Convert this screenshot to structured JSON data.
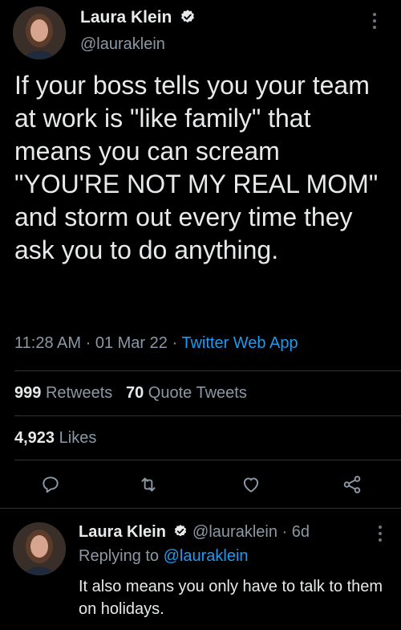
{
  "tweet": {
    "author_name": "Laura Klein",
    "author_handle": "@lauraklein",
    "text": "If your boss tells you your team at work is \"like family\" that means you can scream \"YOU'RE NOT MY REAL MOM\" and storm out every time they ask you to do anything.",
    "time": "11:28 AM",
    "date": "01 Mar 22",
    "separator": "·",
    "source_app": "Twitter Web App",
    "retweets_count": "999",
    "retweets_label": "Retweets",
    "quotes_count": "70",
    "quotes_label": "Quote Tweets",
    "likes_count": "4,923",
    "likes_label": "Likes"
  },
  "reply": {
    "author_name": "Laura Klein",
    "author_handle": "@lauraklein",
    "age": "6d",
    "replying_prefix": "Replying to",
    "replying_to": "@lauraklein",
    "text": "It also means you only have to talk to them on holidays."
  },
  "icons": {
    "verified": "verified-badge-icon",
    "more": "more-vertical-icon",
    "reply": "reply-icon",
    "retweet": "retweet-icon",
    "like": "heart-icon",
    "share": "share-icon"
  },
  "colors": {
    "background": "#000000",
    "text": "#e7e9ea",
    "muted": "#8b98a5",
    "accent": "#1d9bf0",
    "divider": "#2f3336"
  }
}
